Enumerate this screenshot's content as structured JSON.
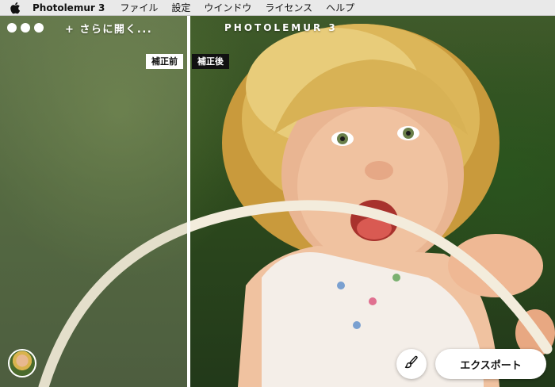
{
  "menubar": {
    "apple_icon": "apple-icon",
    "app_name": "Photolemur 3",
    "items": [
      "ファイル",
      "設定",
      "ウインドウ",
      "ライセンス",
      "ヘルプ"
    ]
  },
  "toolbar": {
    "open_more_label": "+ さらに開く...",
    "logo_text": "PHOTOLEMUR 3"
  },
  "comparison": {
    "before_label": "補正前",
    "after_label": "補正後"
  },
  "footer": {
    "brush_icon": "brush-icon",
    "export_label": "エクスポート"
  },
  "colors": {
    "background": "#2d4a1d",
    "hair": "#d9b34d",
    "skin": "#e8b890",
    "split_line": "#ffffff"
  }
}
